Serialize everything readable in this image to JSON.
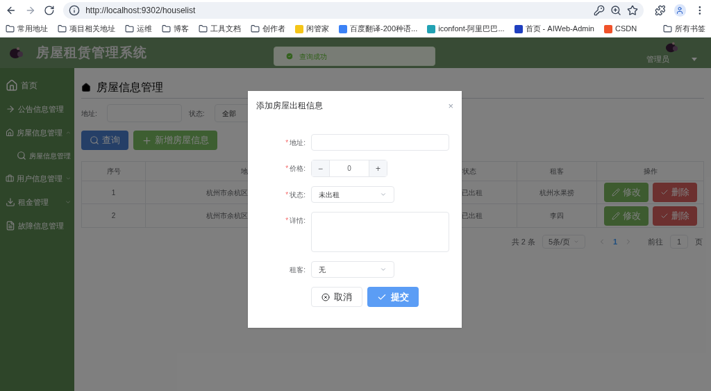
{
  "browser": {
    "url": "http://localhost:9302/houselist",
    "bookmarks": [
      {
        "kind": "folder",
        "label": "常用地址"
      },
      {
        "kind": "folder",
        "label": "项目相关地址"
      },
      {
        "kind": "folder",
        "label": "运维"
      },
      {
        "kind": "folder",
        "label": "博客"
      },
      {
        "kind": "folder",
        "label": "工具文档"
      },
      {
        "kind": "folder",
        "label": "创作者"
      },
      {
        "kind": "site",
        "label": "闲管家",
        "color": "#f5c518"
      },
      {
        "kind": "site",
        "label": "百度翻译-200种语...",
        "color": "#3b82f6"
      },
      {
        "kind": "site",
        "label": "iconfont-阿里巴巴...",
        "color": "#22a2b4"
      },
      {
        "kind": "site",
        "label": "首页 - AIWeb-Admin",
        "color": "#1f3fbf"
      },
      {
        "kind": "site",
        "label": "CSDN",
        "color": "#f0522a"
      }
    ],
    "all_bookmarks": "所有书签"
  },
  "header": {
    "title": "房屋租赁管理系统",
    "user": "管理员"
  },
  "toast": {
    "text": "查询成功"
  },
  "sidebar": {
    "items": [
      {
        "label": "首页"
      },
      {
        "label": "公告信息管理"
      },
      {
        "label": "房屋信息管理",
        "expanded": true,
        "children": [
          {
            "label": "房屋信息管理"
          }
        ]
      },
      {
        "label": "用户信息管理",
        "expanded": false
      },
      {
        "label": "租金管理",
        "expanded": false
      },
      {
        "label": "故障信息管理"
      }
    ]
  },
  "page": {
    "title": "房屋信息管理",
    "filters": [
      {
        "kind": "text",
        "label": "地址:"
      },
      {
        "kind": "select",
        "label": "状态:",
        "value": "全部"
      }
    ],
    "buttons": [
      {
        "kind": "search",
        "label": "查询"
      },
      {
        "kind": "add",
        "label": "新增房屋信息"
      }
    ],
    "table": {
      "columns": [
        "序号",
        "地",
        "状态",
        "租客",
        "操作"
      ],
      "rows": [
        {
          "cells": [
            "1",
            "杭州市余杭区",
            "已出租",
            "杭州水果捞"
          ],
          "actions": [
            "修改",
            "删除"
          ]
        },
        {
          "cells": [
            "2",
            "杭州市余杭区",
            "已出租",
            "李四"
          ],
          "actions": [
            "修改",
            "删除"
          ]
        }
      ]
    },
    "pagination": {
      "total": "共 2 条",
      "page_size": "5条/页",
      "pages": [
        {
          "label": "1",
          "selected": true
        }
      ],
      "goto": "前往",
      "goto_value": "1",
      "page_unit": "页"
    }
  },
  "dialog": {
    "title": "添加房屋出租信息",
    "close": "×",
    "required_mark": "*",
    "fields": [
      {
        "kind": "text",
        "label": "地址:",
        "required": true
      },
      {
        "kind": "number",
        "label": "价格:",
        "required": true,
        "value": "0",
        "minus": "−",
        "plus": "+"
      },
      {
        "kind": "select",
        "label": "状态:",
        "required": true,
        "value": "未出租"
      },
      {
        "kind": "textarea",
        "label": "详情:",
        "required": true
      },
      {
        "kind": "select",
        "label": "租客:",
        "required": false,
        "value": "无"
      }
    ],
    "buttons": [
      {
        "kind": "cancel",
        "label": "取消"
      },
      {
        "kind": "submit",
        "label": "提交"
      }
    ]
  }
}
